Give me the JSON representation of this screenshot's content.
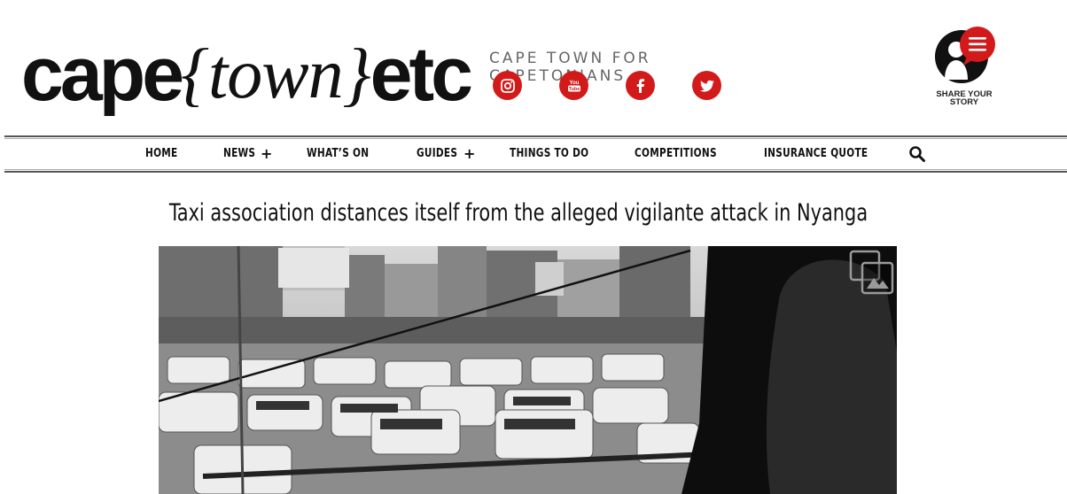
{
  "header": {
    "logo": {
      "part1": "cape",
      "part2": "{town}",
      "part3": "etc"
    },
    "tagline": "CAPE TOWN FOR CAPETONIANS",
    "socials": [
      {
        "icon": "instagram-icon"
      },
      {
        "icon": "youtube-icon",
        "text": "You Tube"
      },
      {
        "icon": "facebook-icon",
        "text": "f"
      },
      {
        "icon": "twitter-icon"
      }
    ],
    "share": {
      "line1": "SHARE YOUR",
      "line2": "STORY"
    }
  },
  "nav": {
    "items": [
      {
        "label": "HOME"
      },
      {
        "label": "NEWS",
        "has_submenu": true
      },
      {
        "label": "WHAT’S ON"
      },
      {
        "label": "GUIDES",
        "has_submenu": true
      },
      {
        "label": "THINGS TO DO"
      },
      {
        "label": "COMPETITIONS"
      },
      {
        "label": "INSURANCE QUOTE"
      }
    ],
    "submenu_symbol": "+",
    "search_icon": "search-icon"
  },
  "article": {
    "headline": "Taxi association distances itself from the alleged vigilante attack in Nyanga"
  },
  "colors": {
    "brand_red": "#d21a1a",
    "text": "#111111",
    "tagline": "#666666"
  }
}
